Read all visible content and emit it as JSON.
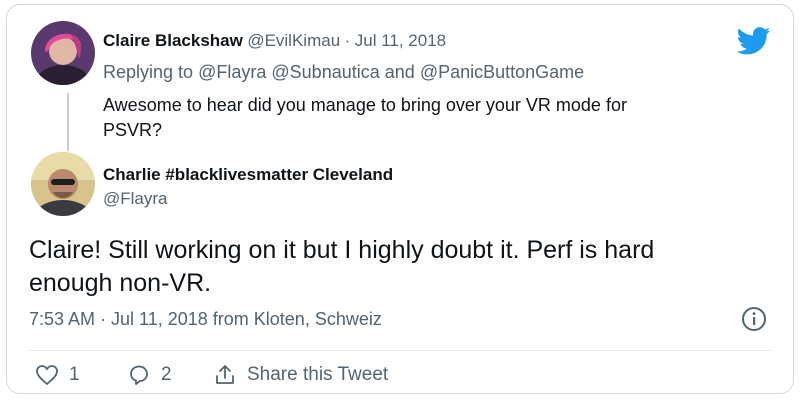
{
  "colors": {
    "brand": "#1d9bf0",
    "text": "#0f1419",
    "muted": "#536471",
    "border": "#cfd9de"
  },
  "icons": [
    "twitter-logo-icon",
    "heart-icon",
    "reply-icon",
    "share-icon",
    "info-icon"
  ],
  "parent_tweet": {
    "author_name": "Claire Blackshaw",
    "author_handle": "@EvilKimau",
    "separator": "·",
    "date": "Jul 11, 2018",
    "replying_label": "Replying to",
    "mentions": [
      "@Flayra",
      "@Subnautica",
      "and",
      "@PanicButtonGame"
    ],
    "body_line1": "Awesome to hear did you manage to bring over your VR mode for",
    "body_line2": "PSVR?"
  },
  "main_tweet": {
    "author_name": "Charlie #blacklivesmatter Cleveland",
    "author_handle": "@Flayra",
    "body_line1": "Claire! Still working on it but I highly doubt it. Perf is hard",
    "body_line2": "enough non-VR.",
    "timestamp": "7:53 AM · Jul 11, 2018 from Kloten, Schweiz"
  },
  "actions": {
    "like_count": "1",
    "reply_count": "2",
    "share_label": "Share this Tweet"
  }
}
